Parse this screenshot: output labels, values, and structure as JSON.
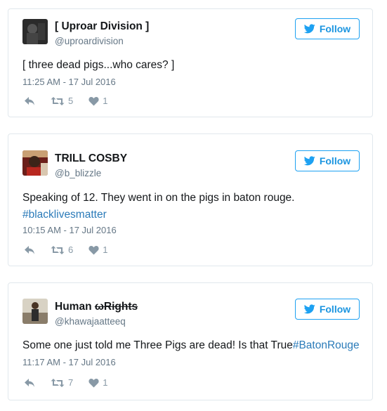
{
  "colors": {
    "accent": "#1da1f2",
    "link": "#2b7bb9",
    "meta": "#657786",
    "actionIcon": "#8899a6"
  },
  "tweets": [
    {
      "name": "[ Uproar Division ]",
      "handle": "@uproardivision",
      "follow_label": "Follow",
      "text": "[ three dead pigs...who cares? ]",
      "hashtag": "",
      "time": "11:25 AM - 17 Jul 2016",
      "retweets": "5",
      "likes": "1"
    },
    {
      "name": "TRILL COSBY",
      "handle": "@b_blizzle",
      "follow_label": "Follow",
      "text": "Speaking of 12. They went in on the pigs in baton rouge.",
      "hashtag": "#blacklivesmatter",
      "time": "10:15 AM - 17 Jul 2016",
      "retweets": "6",
      "likes": "1"
    },
    {
      "name_prefix": "Human ",
      "name_strike": "ωRights",
      "handle": "@khawajaatteeq",
      "follow_label": "Follow",
      "text": "Some one just told me Three Pigs are dead! Is that True",
      "hashtag": "#BatonRouge",
      "time": "11:17 AM - 17 Jul 2016",
      "retweets": "7",
      "likes": "1"
    }
  ]
}
